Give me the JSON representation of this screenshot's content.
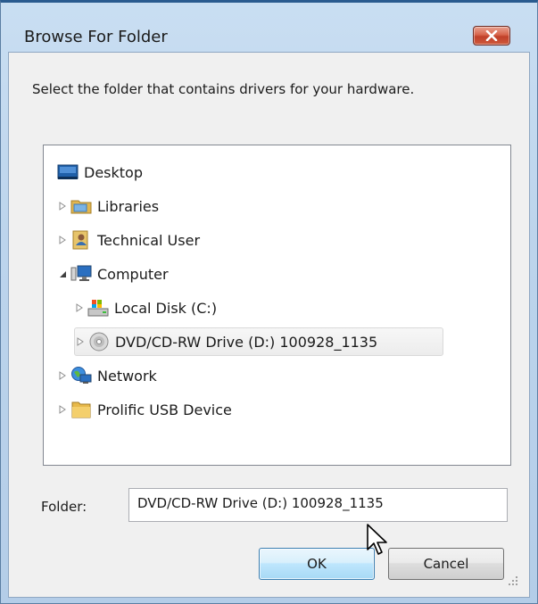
{
  "window": {
    "title": "Browse For Folder",
    "close_icon": "close-x-icon"
  },
  "instruction": "Select the folder that contains drivers for your hardware.",
  "tree": {
    "items": [
      {
        "label": "Desktop",
        "icon": "desktop-icon",
        "expander": "none",
        "level": 0
      },
      {
        "label": "Libraries",
        "icon": "libraries-icon",
        "expander": "collapsed",
        "level": 0
      },
      {
        "label": "Technical User",
        "icon": "user-folder-icon",
        "expander": "collapsed",
        "level": 0
      },
      {
        "label": "Computer",
        "icon": "computer-icon",
        "expander": "expanded",
        "level": 0
      },
      {
        "label": "Local Disk (C:)",
        "icon": "local-disk-icon",
        "expander": "collapsed",
        "level": 1
      },
      {
        "label": "DVD/CD-RW Drive (D:) 100928_1135",
        "icon": "dvd-drive-icon",
        "expander": "collapsed",
        "level": 1,
        "selected": true
      },
      {
        "label": "Network",
        "icon": "network-icon",
        "expander": "collapsed",
        "level": 0
      },
      {
        "label": "Prolific USB Device",
        "icon": "folder-icon",
        "expander": "collapsed",
        "level": 0
      }
    ]
  },
  "folder": {
    "label": "Folder:",
    "value": "DVD/CD-RW Drive (D:) 100928_1135"
  },
  "buttons": {
    "ok": "OK",
    "cancel": "Cancel"
  },
  "colors": {
    "title_bar": "#bcd4ec",
    "close_button": "#c9482f",
    "ok_button_accent": "#3c7fb1"
  }
}
